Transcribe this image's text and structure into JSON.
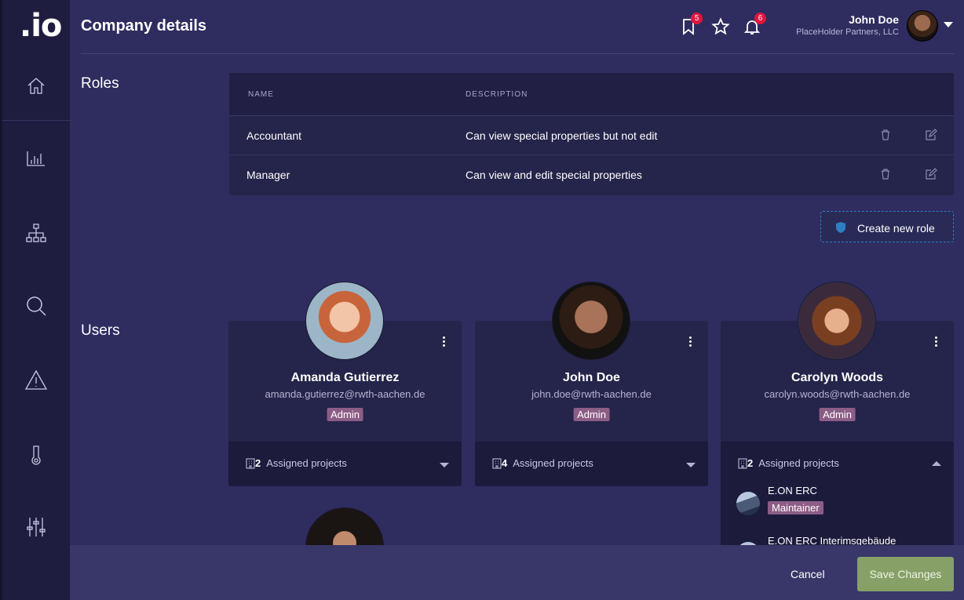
{
  "app": {
    "logo": ".io"
  },
  "header": {
    "title": "Company details",
    "bookmark_count": "5",
    "notification_count": "6",
    "user_name": "John Doe",
    "user_company": "PlaceHolder Partners, LLC"
  },
  "sidebar": {
    "items": [
      "home-icon",
      "chart-icon",
      "hierarchy-icon",
      "search-icon",
      "warning-icon",
      "thermometer-icon",
      "sliders-icon"
    ]
  },
  "roles": {
    "label": "Roles",
    "columns": [
      "NAME",
      "DESCRIPTION"
    ],
    "rows": [
      {
        "name": "Accountant",
        "description": "Can view special properties but not edit"
      },
      {
        "name": "Manager",
        "description": "Can view and edit special properties"
      }
    ],
    "create_label": "Create new role"
  },
  "users": {
    "label": "Users",
    "cards": [
      {
        "name": "Amanda Gutierrez",
        "email": "amanda.gutierrez@rwth-aachen.de",
        "role": "Admin",
        "project_count": "2",
        "projects_label": "Assigned projects"
      },
      {
        "name": "John Doe",
        "email": "john.doe@rwth-aachen.de",
        "role": "Admin",
        "project_count": "4",
        "projects_label": "Assigned projects"
      },
      {
        "name": "Carolyn Woods",
        "email": "carolyn.woods@rwth-aachen.de",
        "role": "Admin",
        "project_count": "2",
        "projects_label": "Assigned projects",
        "projects": [
          {
            "name": "E.ON ERC",
            "role": "Maintainer"
          },
          {
            "name": "E.ON ERC Interimsgebäude",
            "role": ""
          }
        ]
      }
    ]
  },
  "footer": {
    "cancel": "Cancel",
    "save": "Save Changes"
  },
  "colors": {
    "accent": "#86a067",
    "badge": "#8c5d86",
    "alert": "#e0163e"
  }
}
